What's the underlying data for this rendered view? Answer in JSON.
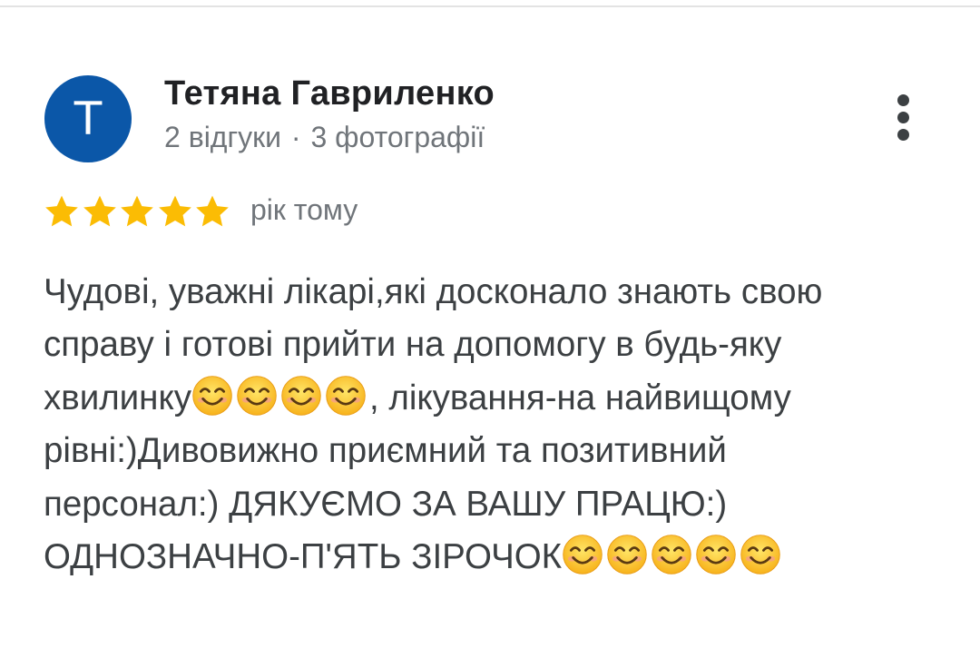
{
  "review": {
    "avatar_letter": "T",
    "author_name": "Тетяна Гавриленко",
    "author_reviews": "2 відгуки",
    "meta_separator": "·",
    "author_photos": "3 фотографії",
    "rating": 5,
    "rating_max": 5,
    "time_ago": "рік тому",
    "text_lines": {
      "l1": "Чудові, уважні лікарі,які досконало знають свою",
      "l2": "справу і готові прийти на допомогу в будь-яку",
      "l3_start": "хвилинку",
      "l3_end": ", лікування-на найвищому",
      "l4": "рівні:)Дивовижно приємний та позитивний",
      "l5": "персонал:) ДЯКУЄМО ЗА ВАШУ ПРАЦЮ:)",
      "l6_start": "ОДНОЗНАЧНО-П'ЯТЬ ЗІРОЧОК"
    },
    "emoji_name": "smiling-face-with-smiling-eyes",
    "emoji_count_line3": 4,
    "emoji_count_line6": 5
  },
  "icons": {
    "more": "more-vert-icon",
    "star": "star-icon"
  },
  "colors": {
    "avatar_bg": "#0b57a8",
    "star": "#fbbc04",
    "text": "#3c4043",
    "secondary": "#70757a",
    "name": "#202124"
  }
}
